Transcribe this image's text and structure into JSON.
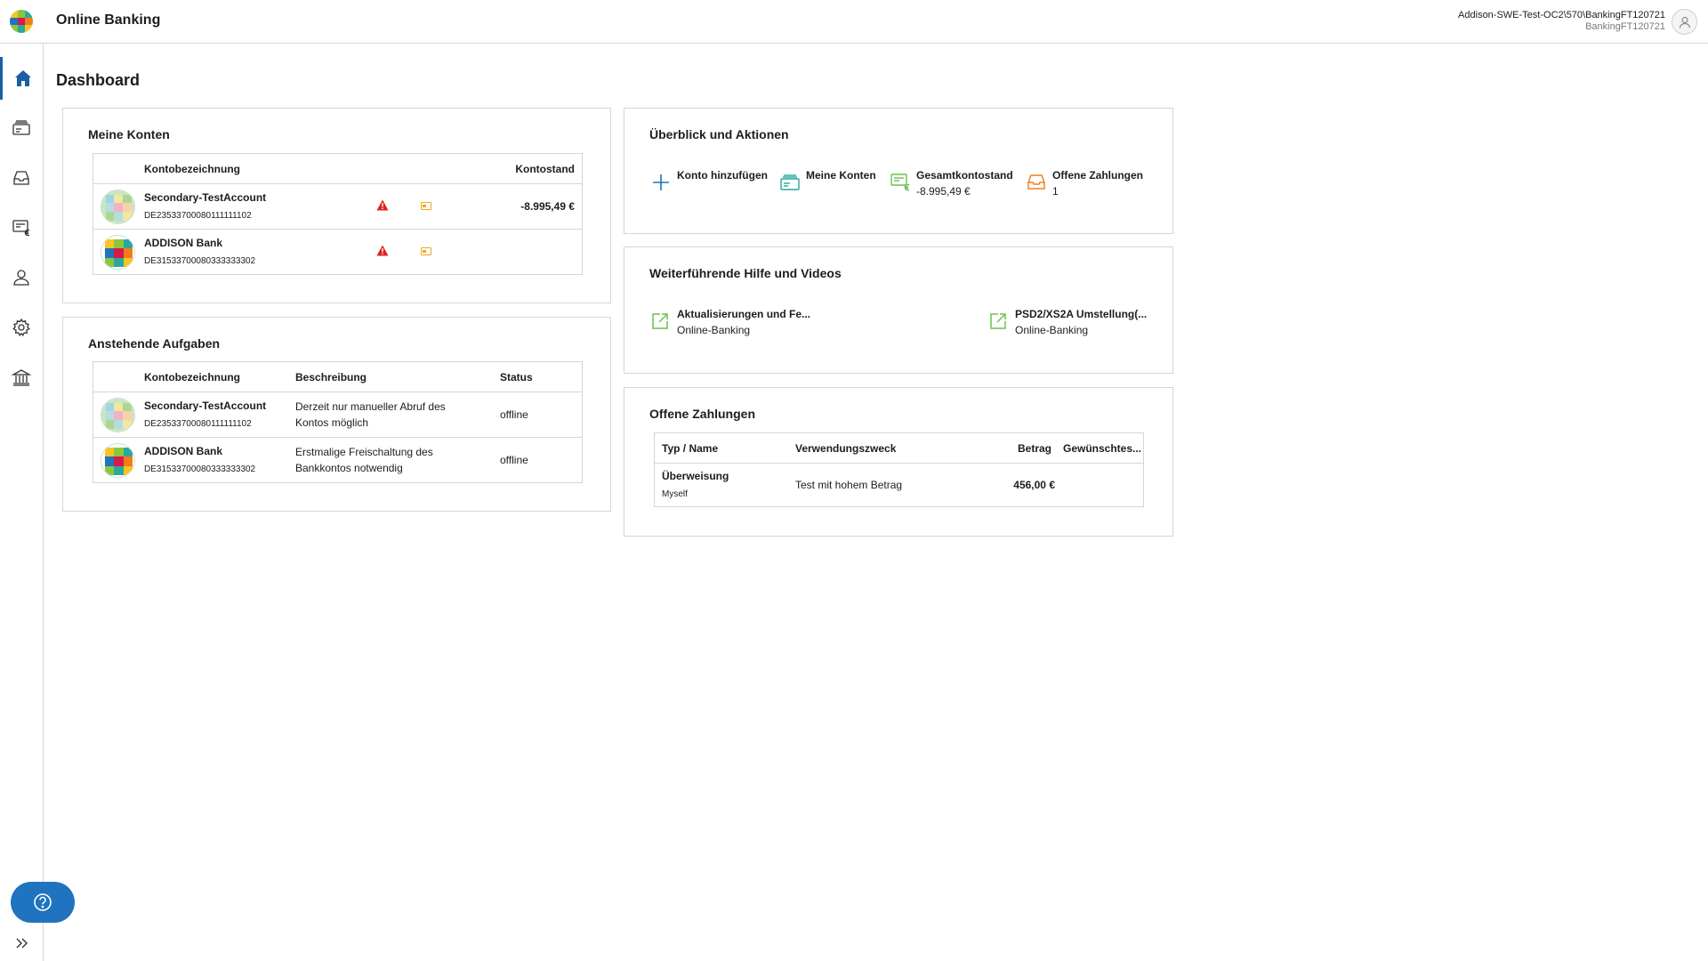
{
  "header": {
    "app_title": "Online Banking",
    "user_main": "Addison-SWE-Test-OC2\\570\\BankingFT120721",
    "user_sub": "BankingFT120721"
  },
  "sidebar": {
    "items": [
      {
        "icon": "home-icon",
        "active": true
      },
      {
        "icon": "accounts-icon"
      },
      {
        "icon": "inbox-icon"
      },
      {
        "icon": "payments-euro-icon"
      },
      {
        "icon": "user-icon"
      },
      {
        "icon": "gear-icon"
      },
      {
        "icon": "bank-building-icon"
      }
    ],
    "help_icon": "question-circle-icon",
    "expand_icon": "double-chevron-right-icon"
  },
  "page": {
    "title": "Dashboard"
  },
  "meine_konten": {
    "title": "Meine Konten",
    "columns": [
      "Kontobezeichnung",
      "Kontostand"
    ],
    "rows": [
      {
        "name": "Secondary-TestAccount",
        "iban": "DE23533700080111111102",
        "balance": "-8.995,49 €"
      },
      {
        "name": "ADDISON Bank",
        "iban": "DE31533700080333333302",
        "balance": ""
      }
    ],
    "warning_color": "#e02020",
    "card_icon_color": "#f2a516"
  },
  "aufgaben": {
    "title": "Anstehende Aufgaben",
    "columns": [
      "Kontobezeichnung",
      "Beschreibung",
      "Status"
    ],
    "rows": [
      {
        "name": "Secondary-TestAccount",
        "iban": "DE23533700080111111102",
        "desc1": "Derzeit nur manueller Abruf des",
        "desc2": "Kontos möglich",
        "status": "offline"
      },
      {
        "name": "ADDISON Bank",
        "iban": "DE31533700080333333302",
        "desc1": "Erstmalige Freischaltung des",
        "desc2": "Bankkontos notwendig",
        "status": "offline"
      }
    ]
  },
  "ueberblick": {
    "title": "Überblick und Aktionen",
    "actions": [
      {
        "label": "Konto hinzufügen",
        "value": "",
        "icon": "plus-icon",
        "color": "#1f73bf"
      },
      {
        "label": "Meine Konten",
        "value": "",
        "icon": "accounts-icon",
        "color": "#2aa7a0"
      },
      {
        "label": "Gesamtkontostand",
        "value": "-8.995,49 €",
        "icon": "balance-euro-icon",
        "color": "#6cc04a"
      },
      {
        "label": "Offene Zahlungen",
        "value": "1",
        "icon": "inbox-icon",
        "color": "#f07d1a"
      }
    ]
  },
  "hilfe": {
    "title": "Weiterführende Hilfe und Videos",
    "links": [
      {
        "label": "Aktualisierungen und Fe...",
        "sub": "Online-Banking",
        "icon": "external-link-icon"
      },
      {
        "label": "PSD2/XS2A Umstellung(...",
        "sub": "Online-Banking",
        "icon": "external-link-icon"
      }
    ],
    "link_color": "#6cc04a"
  },
  "zahlungen": {
    "title": "Offene Zahlungen",
    "columns": [
      "Typ / Name",
      "Verwendungszweck",
      "Betrag",
      "Gewünschtes..."
    ],
    "rows": [
      {
        "type": "Überweisung",
        "name": "Myself",
        "purpose": "Test mit hohem Betrag",
        "amount": "456,00 €"
      }
    ]
  }
}
